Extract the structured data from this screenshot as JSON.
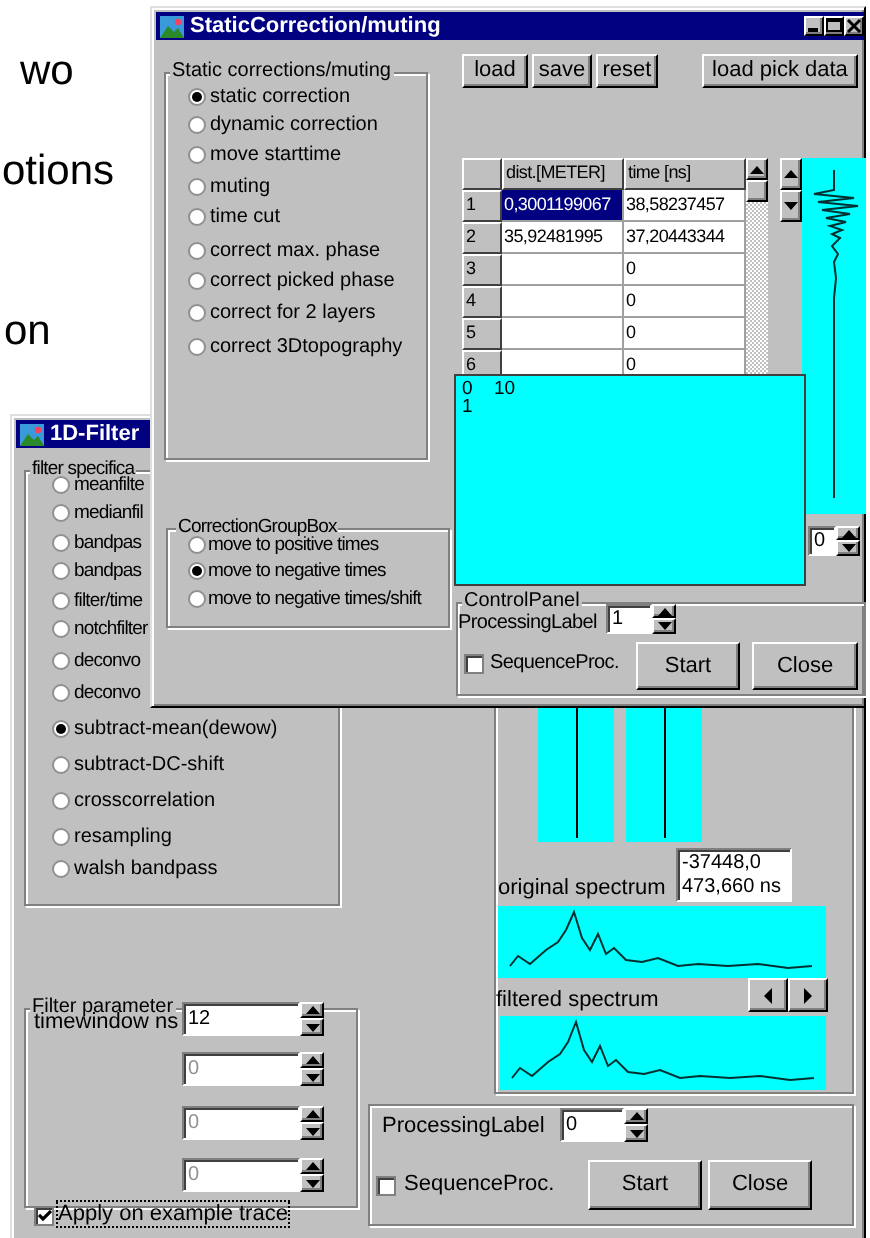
{
  "background_text": [
    "wo",
    "otions",
    "on"
  ],
  "static_window": {
    "title": "StaticCorrection/muting",
    "corrections_group": {
      "label": "Static corrections/muting",
      "options": [
        {
          "label": "static correction",
          "selected": true
        },
        {
          "label": "dynamic correction",
          "selected": false
        },
        {
          "label": "move starttime",
          "selected": false
        },
        {
          "label": "muting",
          "selected": false
        },
        {
          "label": "time cut",
          "selected": false
        },
        {
          "label": "correct max. phase",
          "selected": false
        },
        {
          "label": "correct picked phase",
          "selected": false
        },
        {
          "label": "correct for 2 layers",
          "selected": false
        },
        {
          "label": "correct 3Dtopography",
          "selected": false
        }
      ]
    },
    "correction_group_box": {
      "label": "CorrectionGroupBox",
      "options": [
        {
          "label": "move to positive times",
          "selected": false
        },
        {
          "label": "move to negative times",
          "selected": true
        },
        {
          "label": "move to negative times/shift",
          "selected": false
        }
      ]
    },
    "buttons": [
      "load",
      "save",
      "reset",
      "load pick data"
    ],
    "table": {
      "columns": [
        "dist.[METER]",
        "time [ns]"
      ],
      "rows": [
        {
          "label": "1",
          "dist": "0,3001199067",
          "time": "38,58237457",
          "selected": true
        },
        {
          "label": "2",
          "dist": "35,92481995",
          "time": "37,20443344",
          "selected": false
        },
        {
          "label": "3",
          "time": "0",
          "selected": false
        },
        {
          "label": "4",
          "time": "0",
          "selected": false
        },
        {
          "label": "5",
          "time": "0",
          "selected": false
        },
        {
          "label": "6",
          "time": "0",
          "selected": false
        }
      ]
    },
    "plot_labels": [
      "0",
      "10",
      "1"
    ],
    "side_spin": {
      "value": "0"
    },
    "control_panel": {
      "label": "ControlPanel",
      "processing_label": "ProcessingLabel",
      "processing_value": "1",
      "sequence_label": "SequenceProc.",
      "sequence_checked": false,
      "buttons": [
        "Start",
        "Close"
      ]
    }
  },
  "filter_window": {
    "title": "1D-Filter",
    "filter_group": {
      "label": "filter specifica",
      "options": [
        {
          "label": "meanfilte",
          "selected": false
        },
        {
          "label": "medianfil",
          "selected": false
        },
        {
          "label": "bandpas",
          "selected": false
        },
        {
          "label": "bandpas",
          "selected": false
        },
        {
          "label": "filter/time",
          "selected": false
        },
        {
          "label": "notchfilter",
          "selected": false
        },
        {
          "label": "deconvo",
          "selected": false
        },
        {
          "label": "deconvo",
          "selected": false
        },
        {
          "label": "subtract-mean(dewow)",
          "selected": true
        },
        {
          "label": "subtract-DC-shift",
          "selected": false
        },
        {
          "label": "crosscorrelation",
          "selected": false
        },
        {
          "label": "resampling",
          "selected": false
        },
        {
          "label": "walsh bandpass",
          "selected": false
        }
      ]
    },
    "parameter_group": {
      "label": "Filter parameter",
      "param_label": "timewindow ns",
      "fields": [
        {
          "value": "12",
          "disabled": false
        },
        {
          "value": "0",
          "disabled": true
        },
        {
          "value": "0",
          "disabled": true
        },
        {
          "value": "0",
          "disabled": true
        }
      ]
    },
    "apply_example": {
      "label": "Apply on example trace",
      "checked": true
    },
    "readout": [
      "-37448,0",
      "473,660 ns"
    ],
    "original_label": "original spectrum",
    "filtered_label": "filtered spectrum",
    "bottom_panel": {
      "processing_label": "ProcessingLabel",
      "processing_value": "0",
      "sequence_label": "SequenceProc.",
      "sequence_checked": false,
      "buttons": [
        "Start",
        "Close"
      ]
    }
  }
}
